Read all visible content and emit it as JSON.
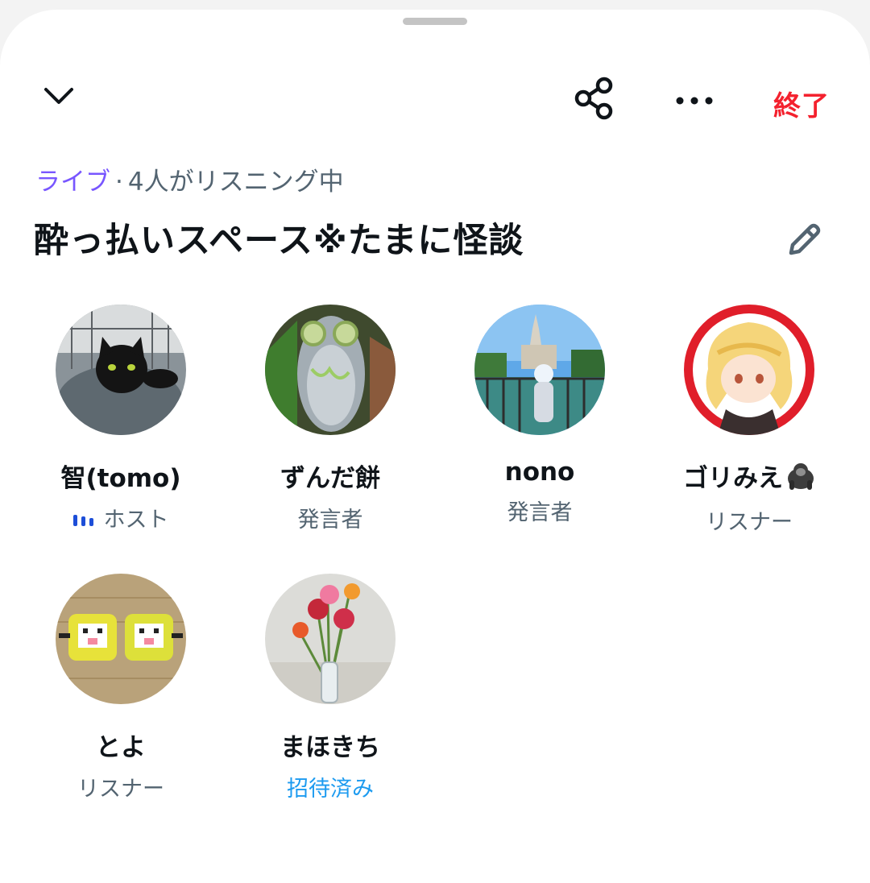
{
  "header": {
    "end_label": "終了",
    "collapse_icon": "chevron-down-icon",
    "share_icon": "share-icon",
    "more_icon": "more-icon",
    "end_color": "#f4212e"
  },
  "space": {
    "live_label": "ライブ",
    "separator": "·",
    "listening": "4人がリスニング中",
    "title": "酔っ払いスペース※たまに怪談",
    "edit_icon": "pencil-icon",
    "accent": "#7856ff"
  },
  "participants": [
    {
      "name": "智(tomo)",
      "role": "ホスト",
      "avatar": "black-cat-avatar"
    },
    {
      "name": "ずんだ餅",
      "role": "発言者",
      "avatar": "fish-avatar"
    },
    {
      "name": "nono",
      "role": "発言者",
      "avatar": "castle-avatar"
    },
    {
      "name": "ゴリみえ",
      "role": "リスナー",
      "avatar": "anime-character-avatar"
    },
    {
      "name": "とよ",
      "role": "リスナー",
      "avatar": "bead-craft-avatar"
    },
    {
      "name": "まほきち",
      "role": "招待済み",
      "avatar": "flowers-avatar"
    }
  ]
}
